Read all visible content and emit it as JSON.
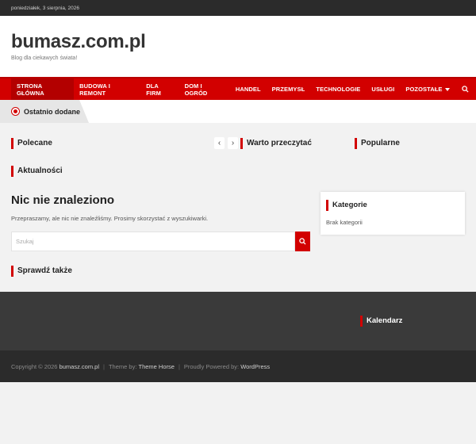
{
  "topbar": {
    "date": "poniedziałek, 3 sierpnia, 2026"
  },
  "header": {
    "title": "bumasz.com.pl",
    "tagline": "Blog dla ciekawych świata!"
  },
  "nav": {
    "items": [
      {
        "label": "STRONA GŁÓWNA",
        "active": true
      },
      {
        "label": "BUDOWA I REMONT"
      },
      {
        "label": "DLA FIRM"
      },
      {
        "label": "DOM I OGRÓD"
      },
      {
        "label": "HANDEL"
      },
      {
        "label": "PRZEMYSŁ"
      },
      {
        "label": "TECHNOLOGIE"
      },
      {
        "label": "USŁUGI"
      },
      {
        "label": "POZOSTAŁE"
      }
    ]
  },
  "recent": {
    "label": "Ostatnio dodane"
  },
  "sections": {
    "polecane": "Polecane",
    "warto": "Warto przeczytać",
    "popularne": "Popularne",
    "aktualnosci": "Aktualności",
    "sprawdz": "Sprawdź także"
  },
  "main": {
    "title": "Nic nie znaleziono",
    "message": "Przepraszamy, ale nic nie znaleźliśmy. Prosimy skorzystać z wyszukiwarki.",
    "search_placeholder": "Szukaj"
  },
  "sidebar": {
    "widget_title": "Kategorie",
    "widget_text": "Brak kategorii"
  },
  "footer": {
    "calendar_title": "Kalendarz",
    "copyright_prefix": "Copyright © 2026",
    "site": "bumasz.com.pl",
    "theme_prefix": "Theme by:",
    "theme_name": "Theme Horse",
    "powered_prefix": "Proudly Powered by:",
    "powered_name": "WordPress"
  },
  "colors": {
    "accent": "#d20000",
    "dark": "#2b2b2b",
    "footer": "#3a3a3a"
  }
}
